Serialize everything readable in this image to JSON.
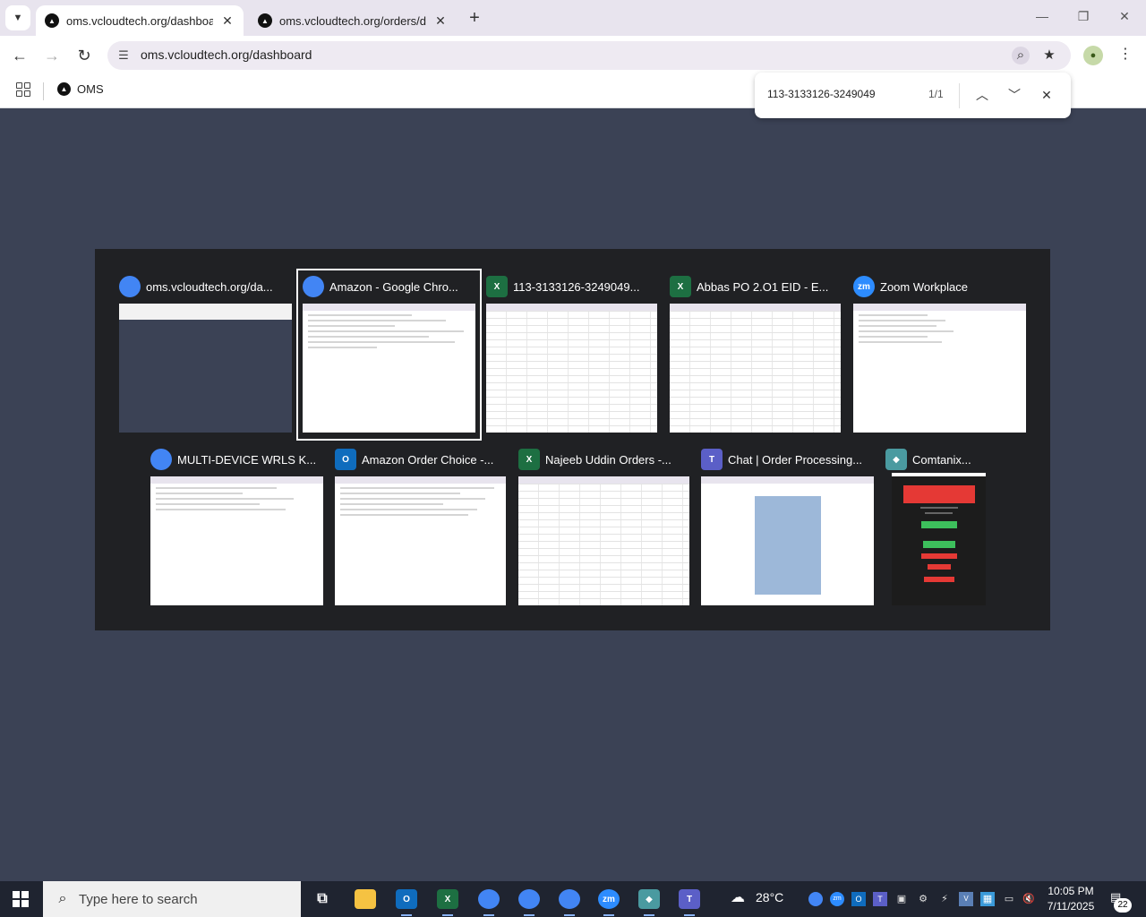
{
  "browser": {
    "tabs": [
      {
        "label": "oms.vcloudtech.org/dashboard",
        "active": true
      },
      {
        "label": "oms.vcloudtech.org/orders/det",
        "active": false
      }
    ],
    "address": "oms.vcloudtech.org/dashboard",
    "bookmarks": [
      {
        "label": "OMS"
      }
    ]
  },
  "findbar": {
    "query": "113-3133126-3249049",
    "count": "1/1"
  },
  "switcher": {
    "windows": [
      {
        "title": "oms.vcloudtech.org/da...",
        "app": "chrome-icon",
        "selected": false
      },
      {
        "title": "Amazon - Google Chro...",
        "app": "chrome-icon",
        "selected": true
      },
      {
        "title": "113-3133126-3249049...",
        "app": "excel-icon",
        "selected": false
      },
      {
        "title": "Abbas PO 2.O1  EID - E...",
        "app": "excel-icon",
        "selected": false
      },
      {
        "title": "Zoom Workplace",
        "app": "zoom-icon",
        "selected": false
      },
      {
        "title": "MULTI-DEVICE WRLS K...",
        "app": "chrome-icon",
        "selected": false
      },
      {
        "title": "Amazon Order Choice -...",
        "app": "outlook-icon",
        "selected": false
      },
      {
        "title": "Najeeb Uddin Orders -...",
        "app": "excel-icon",
        "selected": false
      },
      {
        "title": "Chat | Order Processing...",
        "app": "teams-icon",
        "selected": false
      },
      {
        "title": "Comtanix...",
        "app": "comtanix-icon",
        "selected": false
      }
    ]
  },
  "taskbar": {
    "search_placeholder": "Type here to search",
    "weather": "28°C",
    "time": "10:05 PM",
    "date": "7/11/2025",
    "notifications": "22"
  },
  "colors": {
    "page_bg": "#3b4255",
    "switcher_bg": "#202124",
    "taskbar_bg": "#1f2430",
    "chrome": "#4285f4",
    "excel": "#1d6f42",
    "outlook": "#0f6cbd",
    "zoom": "#2d8cff",
    "teams": "#5b5fc7"
  }
}
